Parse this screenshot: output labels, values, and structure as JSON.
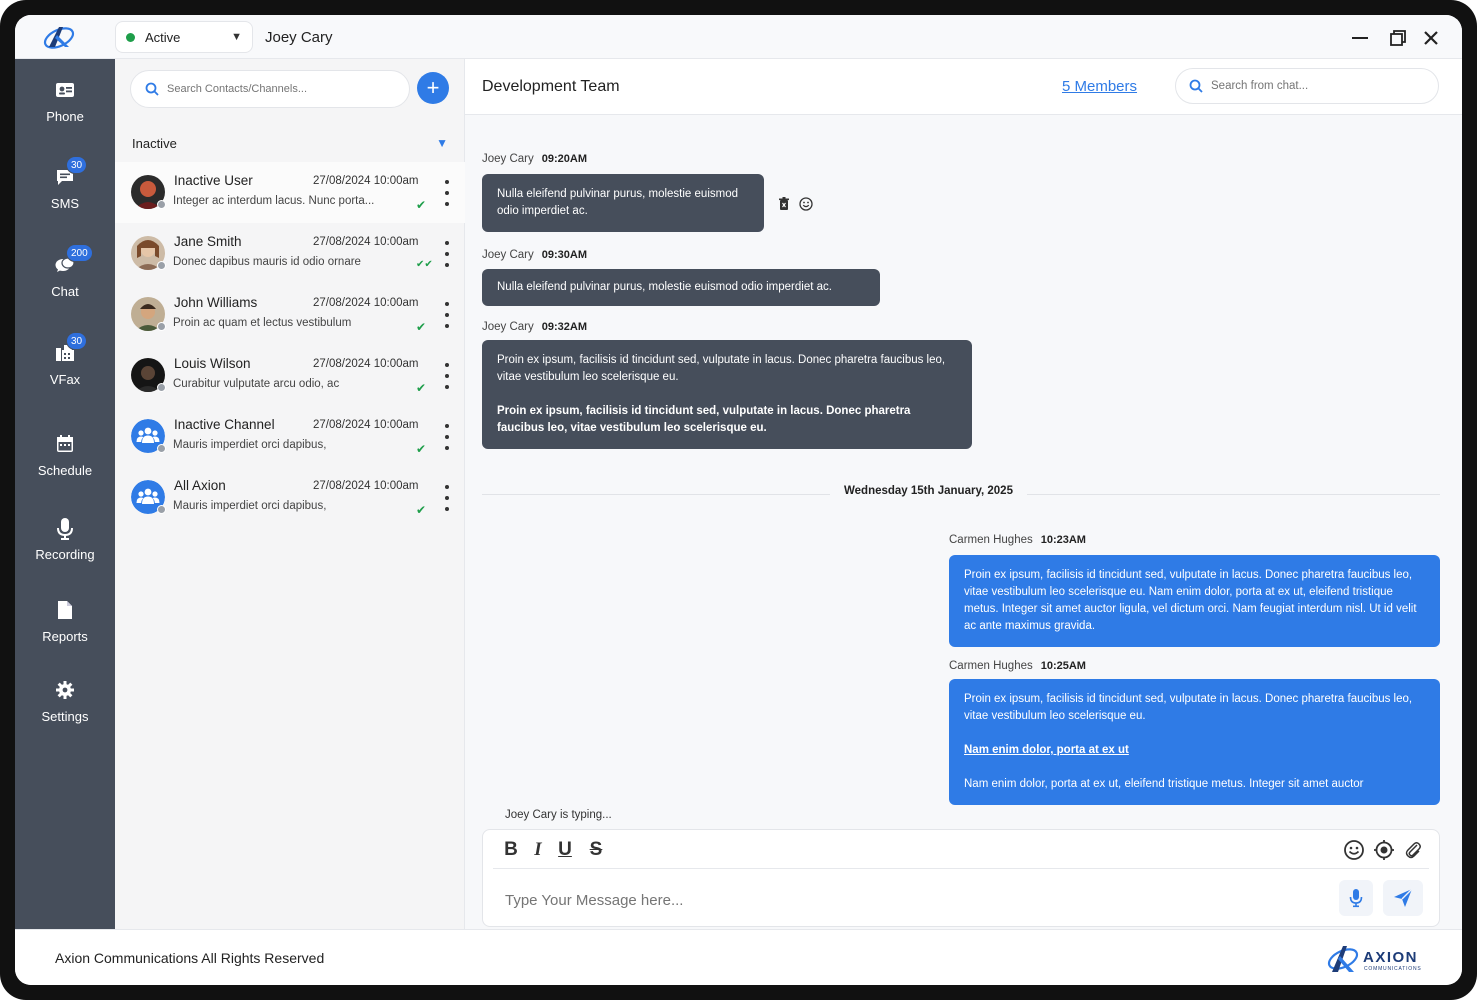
{
  "titlebar": {
    "status": "Active",
    "status_color": "#1e9e4a",
    "user": "Joey Cary"
  },
  "nav": [
    {
      "label": "Phone",
      "icon": "phone-card-icon",
      "badge": ""
    },
    {
      "label": "SMS",
      "icon": "sms-icon",
      "badge": "30"
    },
    {
      "label": "Chat",
      "icon": "chat-icon",
      "badge": "200"
    },
    {
      "label": "VFax",
      "icon": "fax-icon",
      "badge": "30"
    },
    {
      "label": "Schedule",
      "icon": "calendar-icon",
      "badge": ""
    },
    {
      "label": "Recording",
      "icon": "microphone-icon",
      "badge": ""
    },
    {
      "label": "Reports",
      "icon": "document-icon",
      "badge": ""
    },
    {
      "label": "Settings",
      "icon": "gear-icon",
      "badge": ""
    }
  ],
  "contacts": {
    "search_placeholder": "Search Contacts/Channels...",
    "group": "Inactive",
    "items": [
      {
        "name": "Inactive User",
        "date": "27/08/2024 10:00am",
        "preview": "Integer ac interdum lacus. Nunc porta...",
        "check": "✔"
      },
      {
        "name": "Jane Smith",
        "date": "27/08/2024 10:00am",
        "preview": "Donec dapibus mauris id odio ornare",
        "check": "✔✔"
      },
      {
        "name": "John Williams",
        "date": "27/08/2024 10:00am",
        "preview": "Proin ac quam et lectus vestibulum",
        "check": "✔"
      },
      {
        "name": "Louis Wilson",
        "date": "27/08/2024 10:00am",
        "preview": "Curabitur vulputate arcu odio, ac",
        "check": "✔"
      },
      {
        "name": "Inactive Channel",
        "date": "27/08/2024 10:00am",
        "preview": "Mauris imperdiet orci dapibus,",
        "check": "✔"
      },
      {
        "name": "All Axion",
        "date": "27/08/2024 10:00am",
        "preview": "Mauris imperdiet orci dapibus,",
        "check": "✔"
      }
    ]
  },
  "chat": {
    "title": "Development Team",
    "members": "5 Members",
    "search_placeholder": "Search from chat...",
    "messages": [
      {
        "sender": "Joey Cary",
        "time": "09:20AM",
        "text": "Nulla eleifend pulvinar purus, molestie euismod odio imperdiet ac."
      },
      {
        "sender": "Joey Cary",
        "time": "09:30AM",
        "text": "Nulla eleifend pulvinar purus, molestie euismod odio imperdiet ac."
      },
      {
        "sender": "Joey Cary",
        "time": "09:32AM",
        "text": "Proin ex ipsum, facilisis id tincidunt sed, vulputate in lacus. Donec pharetra faucibus leo, vitae vestibulum leo scelerisque eu.",
        "text_bold": "Proin ex ipsum, facilisis id tincidunt sed, vulputate in lacus. Donec pharetra faucibus leo, vitae vestibulum leo scelerisque eu."
      },
      {
        "sender": "Carmen Hughes",
        "time": "10:23AM",
        "text": "Proin ex ipsum, facilisis id tincidunt sed, vulputate in lacus. Donec pharetra faucibus leo, vitae vestibulum leo scelerisque eu. Nam enim dolor, porta at ex ut, eleifend tristique metus. Integer sit amet auctor ligula, vel dictum orci. Nam feugiat interdum nisl. Ut id velit ac ante maximus gravida."
      },
      {
        "sender": "Carmen Hughes",
        "time": "10:25AM",
        "text": "Proin ex ipsum, facilisis id tincidunt sed, vulputate in lacus. Donec pharetra faucibus leo, vitae vestibulum leo scelerisque eu.",
        "link": "Nam enim dolor, porta at ex ut",
        "text_after": "Nam enim dolor, porta at ex ut, eleifend tristique metus. Integer sit amet auctor"
      }
    ],
    "date_separator": "Wednesday 15th January, 2025",
    "typing": "Joey Cary is typing...",
    "composer_placeholder": "Type Your Message here..."
  },
  "footer": {
    "copyright": "Axion Communications All Rights Reserved",
    "brand": "AXION",
    "brand_sub": "COMMUNICATIONS"
  },
  "colors": {
    "sidebar": "#464e5b",
    "accent": "#2f7be6",
    "bubble_dark": "#464e5b"
  }
}
